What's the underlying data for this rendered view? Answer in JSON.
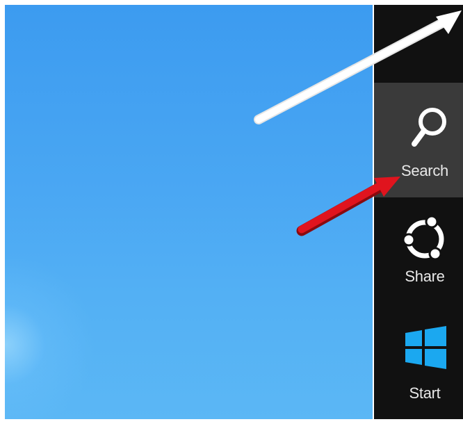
{
  "charms": [
    {
      "label": "Search",
      "icon": "search-icon",
      "highlighted": true
    },
    {
      "label": "Share",
      "icon": "share-icon",
      "highlighted": false
    },
    {
      "label": "Start",
      "icon": "windows-logo-icon",
      "highlighted": false
    }
  ],
  "colors": {
    "desktop_top": "#3c9bf0",
    "desktop_bottom": "#5bb7f5",
    "charms_bar": "#111111",
    "highlight": "#3a3a3a",
    "windows_logo": "#1ba8f0",
    "red_arrow": "#e0141e",
    "white_arrow": "#ffffff"
  }
}
